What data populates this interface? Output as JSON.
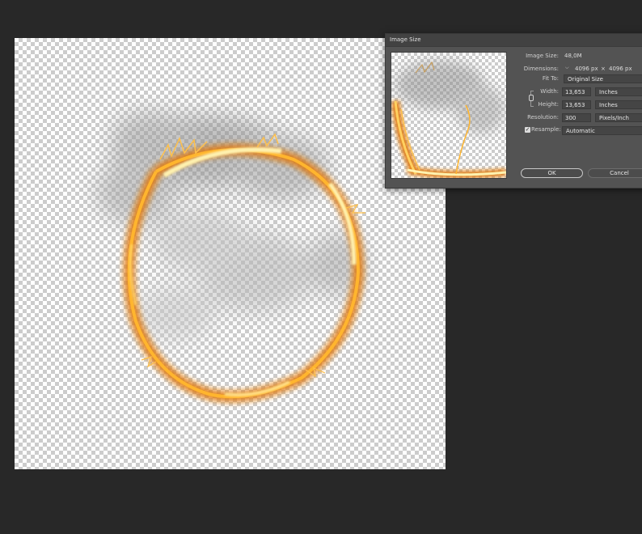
{
  "dialog": {
    "title": "Image Size",
    "image_size_label": "Image Size:",
    "image_size_value": "48,0M",
    "dimensions_label": "Dimensions:",
    "dimensions_width": "4096 px",
    "dimensions_sep": "×",
    "dimensions_height": "4096 px",
    "fit_to_label": "Fit To:",
    "fit_to_value": "Original Size",
    "width_label": "Width:",
    "width_value": "13,653",
    "width_unit": "Inches",
    "height_label": "Height:",
    "height_value": "13,653",
    "height_unit": "Inches",
    "resolution_label": "Resolution:",
    "resolution_value": "300",
    "resolution_unit": "Pixels/Inch",
    "resample_label": "Resample:",
    "resample_checked": true,
    "resample_value": "Automatic",
    "ok_label": "OK",
    "cancel_label": "Cancel"
  },
  "icons": {
    "checkmark": "✓",
    "chevron": "⌵"
  },
  "colors": {
    "workspace": "#282828",
    "dialog": "#535353",
    "fire_core": "#fff2b0",
    "fire_mid": "#ffb52e",
    "fire_outer": "#e07a10",
    "smoke": "#9a9a9a"
  }
}
